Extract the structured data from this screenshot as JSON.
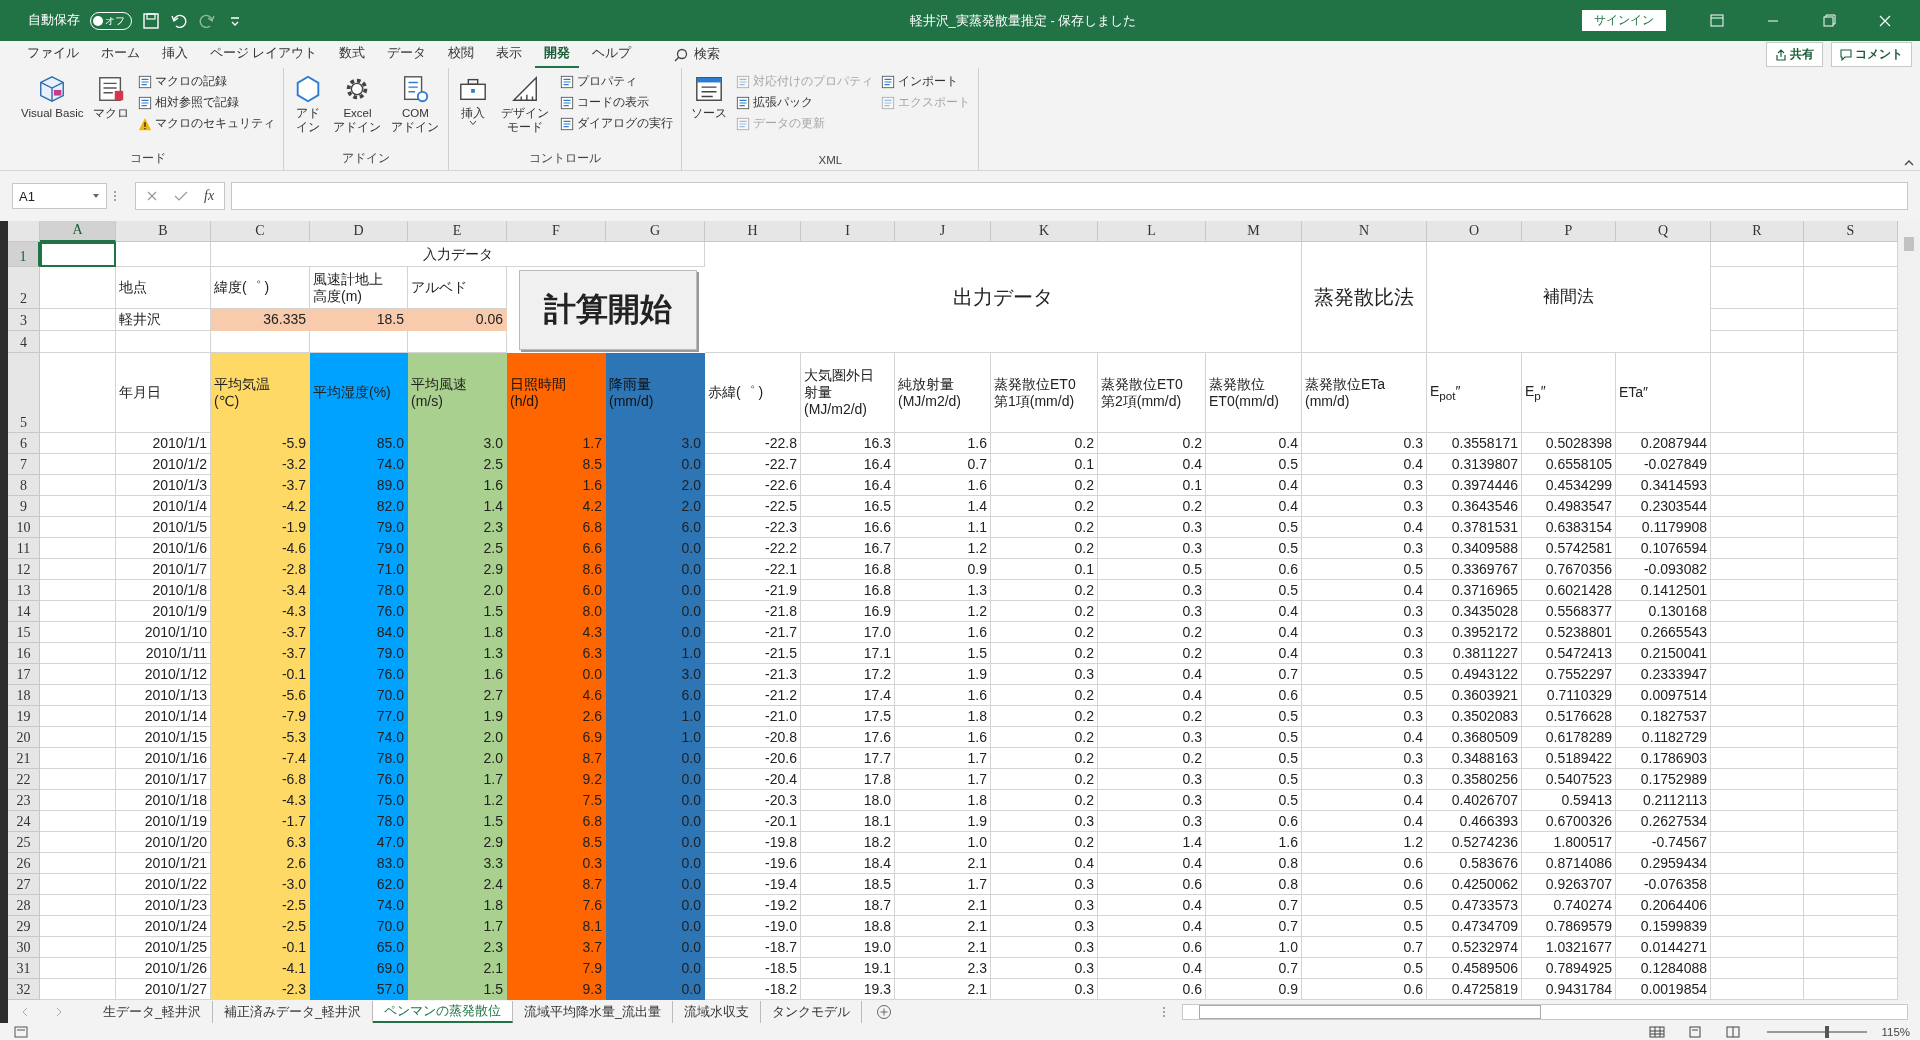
{
  "window": {
    "autosave_label": "自動保存",
    "autosave_state": "オフ",
    "autosave_on": false,
    "title": "軽井沢_実蒸発散量推定  -  保存しました",
    "signin": "サインイン"
  },
  "ribbon_tabs": [
    {
      "label": "ファイル",
      "selected": false
    },
    {
      "label": "ホーム",
      "selected": false
    },
    {
      "label": "挿入",
      "selected": false
    },
    {
      "label": "ページ レイアウト",
      "selected": false
    },
    {
      "label": "数式",
      "selected": false
    },
    {
      "label": "データ",
      "selected": false
    },
    {
      "label": "校閲",
      "selected": false
    },
    {
      "label": "表示",
      "selected": false
    },
    {
      "label": "開発",
      "selected": true
    },
    {
      "label": "ヘルプ",
      "selected": false
    }
  ],
  "search": {
    "label": "検索"
  },
  "share": "共有",
  "comment": "コメント",
  "ribbon_groups": [
    {
      "label": "コード",
      "items": [
        {
          "kind": "large",
          "label": "Visual Basic",
          "disabled": false
        },
        {
          "kind": "large",
          "label": "マクロ",
          "disabled": false
        },
        {
          "kind": "small",
          "label": "マクロの記録",
          "disabled": false
        },
        {
          "kind": "small",
          "label": "相対参照で記録",
          "disabled": false
        },
        {
          "kind": "small",
          "label": "マクロのセキュリティ",
          "disabled": false
        }
      ]
    },
    {
      "label": "アドイン",
      "items": [
        {
          "kind": "large",
          "label": "アドイン",
          "disabled": false
        },
        {
          "kind": "large",
          "label": "Excel\nアドイン",
          "disabled": false
        },
        {
          "kind": "large",
          "label": "COM\nアドイン",
          "disabled": false
        }
      ]
    },
    {
      "label": "コントロール",
      "items": [
        {
          "kind": "large",
          "label": "挿入",
          "disabled": false
        },
        {
          "kind": "large",
          "label": "デザインモード",
          "disabled": false
        },
        {
          "kind": "small",
          "label": "プロパティ",
          "disabled": false
        },
        {
          "kind": "small",
          "label": "コードの表示",
          "disabled": false
        },
        {
          "kind": "small",
          "label": "ダイアログの実行",
          "disabled": false
        }
      ]
    },
    {
      "label": "XML",
      "items": [
        {
          "kind": "large",
          "label": "ソース",
          "disabled": false
        },
        {
          "kind": "small",
          "label": "対応付けのプロパティ",
          "disabled": true
        },
        {
          "kind": "small",
          "label": "拡張パック",
          "disabled": false
        },
        {
          "kind": "small",
          "label": "データの更新",
          "disabled": true
        },
        {
          "kind": "small",
          "label": "インポート",
          "disabled": false
        },
        {
          "kind": "small",
          "label": "エクスポート",
          "disabled": true
        }
      ]
    }
  ],
  "formula_bar": {
    "name_box": "A1",
    "function_label": "fx"
  },
  "sheet": {
    "column_headers": [
      {
        "label": "A",
        "selected": true
      },
      {
        "label": "B",
        "selected": false
      },
      {
        "label": "C",
        "selected": false
      },
      {
        "label": "D",
        "selected": false
      },
      {
        "label": "E",
        "selected": false
      },
      {
        "label": "F",
        "selected": false
      },
      {
        "label": "G",
        "selected": false
      },
      {
        "label": "H",
        "selected": false
      },
      {
        "label": "I",
        "selected": false
      },
      {
        "label": "J",
        "selected": false
      },
      {
        "label": "K",
        "selected": false
      },
      {
        "label": "L",
        "selected": false
      },
      {
        "label": "M",
        "selected": false
      },
      {
        "label": "N",
        "selected": false
      },
      {
        "label": "O",
        "selected": false
      },
      {
        "label": "P",
        "selected": false
      },
      {
        "label": "Q",
        "selected": false
      },
      {
        "label": "R",
        "selected": false
      },
      {
        "label": "S",
        "selected": false
      }
    ],
    "row_headers": [
      {
        "label": "1",
        "selected": true
      },
      {
        "label": "2",
        "selected": false
      },
      {
        "label": "3",
        "selected": false
      },
      {
        "label": "4",
        "selected": false
      },
      {
        "label": "5",
        "selected": false
      },
      {
        "label": "6",
        "selected": false
      },
      {
        "label": "7",
        "selected": false
      },
      {
        "label": "8",
        "selected": false
      },
      {
        "label": "9",
        "selected": false
      },
      {
        "label": "10",
        "selected": false
      },
      {
        "label": "11",
        "selected": false
      },
      {
        "label": "12",
        "selected": false
      },
      {
        "label": "13",
        "selected": false
      },
      {
        "label": "14",
        "selected": false
      },
      {
        "label": "15",
        "selected": false
      },
      {
        "label": "16",
        "selected": false
      },
      {
        "label": "17",
        "selected": false
      },
      {
        "label": "18",
        "selected": false
      },
      {
        "label": "19",
        "selected": false
      },
      {
        "label": "20",
        "selected": false
      },
      {
        "label": "21",
        "selected": false
      },
      {
        "label": "22",
        "selected": false
      },
      {
        "label": "23",
        "selected": false
      },
      {
        "label": "24",
        "selected": false
      },
      {
        "label": "25",
        "selected": false
      },
      {
        "label": "26",
        "selected": false
      },
      {
        "label": "27",
        "selected": false
      },
      {
        "label": "28",
        "selected": false
      },
      {
        "label": "29",
        "selected": false
      },
      {
        "label": "30",
        "selected": false
      },
      {
        "label": "31",
        "selected": false
      },
      {
        "label": "32",
        "selected": false
      }
    ],
    "input_title": "入力データ",
    "output_title": "出力データ",
    "ratio_title": "蒸発散比法",
    "interp_title": "補間法",
    "site": {
      "label": "地点",
      "value": "軽井沢"
    },
    "params": [
      {
        "label": "緯度(゜ )",
        "value": "36.335"
      },
      {
        "label": "風速計地上高度(m)",
        "value": "18.5"
      },
      {
        "label": "アルベド",
        "value": "0.06"
      }
    ],
    "button": "計算開始",
    "date_header": "年月日",
    "input_columns": [
      {
        "header": "平均気温\n(℃)",
        "color": "#ffd966"
      },
      {
        "header": "平均湿度(%)",
        "color": "#00a2ff"
      },
      {
        "header": "平均風速\n(m/s)",
        "color": "#a9d08e"
      },
      {
        "header": "日照時間\n(h/d)",
        "color": "#ff6600"
      },
      {
        "header": "降雨量\n(mm/d)",
        "color": "#2e75b6"
      }
    ],
    "output_columns": [
      {
        "header": "赤緯(゜ )"
      },
      {
        "header": "大気圏外日射量\n(MJ/m2/d)"
      },
      {
        "header": "純放射量\n(MJ/m2/d)"
      },
      {
        "header": "蒸発散位ET0\n第1項(mm/d)"
      },
      {
        "header": "蒸発散位ET0\n第2項(mm/d)"
      },
      {
        "header": "蒸発散位\nET0(mm/d)"
      },
      {
        "header": "蒸発散位ETa\n(mm/d)"
      },
      {
        "header": "E$_{pot}$″"
      },
      {
        "header": "E$_{p}$″"
      },
      {
        "header": "ETa″"
      }
    ],
    "rows": [
      [
        "2010/1/1",
        "-5.9",
        "85.0",
        "3.0",
        "1.7",
        "3.0",
        "-22.8",
        "16.3",
        "1.6",
        "0.2",
        "0.2",
        "0.4",
        "0.3",
        "0.3558171",
        "0.5028398",
        "0.2087944"
      ],
      [
        "2010/1/2",
        "-3.2",
        "74.0",
        "2.5",
        "8.5",
        "0.0",
        "-22.7",
        "16.4",
        "0.7",
        "0.1",
        "0.4",
        "0.5",
        "0.4",
        "0.3139807",
        "0.6558105",
        "-0.027849"
      ],
      [
        "2010/1/3",
        "-3.7",
        "89.0",
        "1.6",
        "1.6",
        "2.0",
        "-22.6",
        "16.4",
        "1.6",
        "0.2",
        "0.1",
        "0.4",
        "0.3",
        "0.3974446",
        "0.4534299",
        "0.3414593"
      ],
      [
        "2010/1/4",
        "-4.2",
        "82.0",
        "1.4",
        "4.2",
        "2.0",
        "-22.5",
        "16.5",
        "1.4",
        "0.2",
        "0.2",
        "0.4",
        "0.3",
        "0.3643546",
        "0.4983547",
        "0.2303544"
      ],
      [
        "2010/1/5",
        "-1.9",
        "79.0",
        "2.3",
        "6.8",
        "6.0",
        "-22.3",
        "16.6",
        "1.1",
        "0.2",
        "0.3",
        "0.5",
        "0.4",
        "0.3781531",
        "0.6383154",
        "0.1179908"
      ],
      [
        "2010/1/6",
        "-4.6",
        "79.0",
        "2.5",
        "6.6",
        "0.0",
        "-22.2",
        "16.7",
        "1.2",
        "0.2",
        "0.3",
        "0.5",
        "0.3",
        "0.3409588",
        "0.5742581",
        "0.1076594"
      ],
      [
        "2010/1/7",
        "-2.8",
        "71.0",
        "2.9",
        "8.6",
        "0.0",
        "-22.1",
        "16.8",
        "0.9",
        "0.1",
        "0.5",
        "0.6",
        "0.5",
        "0.3369767",
        "0.7670356",
        "-0.093082"
      ],
      [
        "2010/1/8",
        "-3.4",
        "78.0",
        "2.0",
        "6.0",
        "0.0",
        "-21.9",
        "16.8",
        "1.3",
        "0.2",
        "0.3",
        "0.5",
        "0.4",
        "0.3716965",
        "0.6021428",
        "0.1412501"
      ],
      [
        "2010/1/9",
        "-4.3",
        "76.0",
        "1.5",
        "8.0",
        "0.0",
        "-21.8",
        "16.9",
        "1.2",
        "0.2",
        "0.3",
        "0.4",
        "0.3",
        "0.3435028",
        "0.5568377",
        "0.130168"
      ],
      [
        "2010/1/10",
        "-3.7",
        "84.0",
        "1.8",
        "4.3",
        "0.0",
        "-21.7",
        "17.0",
        "1.6",
        "0.2",
        "0.2",
        "0.4",
        "0.3",
        "0.3952172",
        "0.5238801",
        "0.2665543"
      ],
      [
        "2010/1/11",
        "-3.7",
        "79.0",
        "1.3",
        "6.3",
        "1.0",
        "-21.5",
        "17.1",
        "1.5",
        "0.2",
        "0.2",
        "0.4",
        "0.3",
        "0.3811227",
        "0.5472413",
        "0.2150041"
      ],
      [
        "2010/1/12",
        "-0.1",
        "76.0",
        "1.6",
        "0.0",
        "3.0",
        "-21.3",
        "17.2",
        "1.9",
        "0.3",
        "0.4",
        "0.7",
        "0.5",
        "0.4943122",
        "0.7552297",
        "0.2333947"
      ],
      [
        "2010/1/13",
        "-5.6",
        "70.0",
        "2.7",
        "4.6",
        "6.0",
        "-21.2",
        "17.4",
        "1.6",
        "0.2",
        "0.4",
        "0.6",
        "0.5",
        "0.3603921",
        "0.7110329",
        "0.0097514"
      ],
      [
        "2010/1/14",
        "-7.9",
        "77.0",
        "1.9",
        "2.6",
        "1.0",
        "-21.0",
        "17.5",
        "1.8",
        "0.2",
        "0.2",
        "0.5",
        "0.3",
        "0.3502083",
        "0.5176628",
        "0.1827537"
      ],
      [
        "2010/1/15",
        "-5.3",
        "74.0",
        "2.0",
        "6.9",
        "1.0",
        "-20.8",
        "17.6",
        "1.6",
        "0.2",
        "0.3",
        "0.5",
        "0.4",
        "0.3680509",
        "0.6178289",
        "0.1182729"
      ],
      [
        "2010/1/16",
        "-7.4",
        "78.0",
        "2.0",
        "8.7",
        "0.0",
        "-20.6",
        "17.7",
        "1.7",
        "0.2",
        "0.2",
        "0.5",
        "0.3",
        "0.3488163",
        "0.5189422",
        "0.1786903"
      ],
      [
        "2010/1/17",
        "-6.8",
        "76.0",
        "1.7",
        "9.2",
        "0.0",
        "-20.4",
        "17.8",
        "1.7",
        "0.2",
        "0.3",
        "0.5",
        "0.3",
        "0.3580256",
        "0.5407523",
        "0.1752989"
      ],
      [
        "2010/1/18",
        "-4.3",
        "75.0",
        "1.2",
        "7.5",
        "0.0",
        "-20.3",
        "18.0",
        "1.8",
        "0.2",
        "0.3",
        "0.5",
        "0.4",
        "0.4026707",
        "0.59413",
        "0.2112113"
      ],
      [
        "2010/1/19",
        "-1.7",
        "78.0",
        "1.5",
        "6.8",
        "0.0",
        "-20.1",
        "18.1",
        "1.9",
        "0.3",
        "0.3",
        "0.6",
        "0.4",
        "0.466393",
        "0.6700326",
        "0.2627534"
      ],
      [
        "2010/1/20",
        "6.3",
        "47.0",
        "2.9",
        "8.5",
        "0.0",
        "-19.8",
        "18.2",
        "1.0",
        "0.2",
        "1.4",
        "1.6",
        "1.2",
        "0.5274236",
        "1.800517",
        "-0.74567"
      ],
      [
        "2010/1/21",
        "2.6",
        "83.0",
        "3.3",
        "0.3",
        "0.0",
        "-19.6",
        "18.4",
        "2.1",
        "0.4",
        "0.4",
        "0.8",
        "0.6",
        "0.583676",
        "0.8714086",
        "0.2959434"
      ],
      [
        "2010/1/22",
        "-3.0",
        "62.0",
        "2.4",
        "8.7",
        "0.0",
        "-19.4",
        "18.5",
        "1.7",
        "0.3",
        "0.6",
        "0.8",
        "0.6",
        "0.4250062",
        "0.9263707",
        "-0.076358"
      ],
      [
        "2010/1/23",
        "-2.5",
        "74.0",
        "1.8",
        "7.6",
        "0.0",
        "-19.2",
        "18.7",
        "2.1",
        "0.3",
        "0.4",
        "0.7",
        "0.5",
        "0.4733573",
        "0.740274",
        "0.2064406"
      ],
      [
        "2010/1/24",
        "-2.5",
        "70.0",
        "1.7",
        "8.1",
        "0.0",
        "-19.0",
        "18.8",
        "2.1",
        "0.3",
        "0.4",
        "0.7",
        "0.5",
        "0.4734709",
        "0.7869579",
        "0.1599839"
      ],
      [
        "2010/1/25",
        "-0.1",
        "65.0",
        "2.3",
        "3.7",
        "0.0",
        "-18.7",
        "19.0",
        "2.1",
        "0.3",
        "0.6",
        "1.0",
        "0.7",
        "0.5232974",
        "1.0321677",
        "0.0144271"
      ],
      [
        "2010/1/26",
        "-4.1",
        "69.0",
        "2.1",
        "7.9",
        "0.0",
        "-18.5",
        "19.1",
        "2.3",
        "0.3",
        "0.4",
        "0.7",
        "0.5",
        "0.4589506",
        "0.7894925",
        "0.1284088"
      ],
      [
        "2010/1/27",
        "-2.3",
        "57.0",
        "1.5",
        "9.3",
        "0.0",
        "-18.2",
        "19.3",
        "2.1",
        "0.3",
        "0.6",
        "0.9",
        "0.6",
        "0.4725819",
        "0.9431784",
        "0.0019854"
      ]
    ]
  },
  "sheet_tabs": [
    {
      "label": "生データ_軽井沢",
      "selected": false
    },
    {
      "label": "補正済みデータ_軽井沢",
      "selected": false
    },
    {
      "label": "ペンマンの蒸発散位",
      "selected": true
    },
    {
      "label": "流域平均降水量_流出量",
      "selected": false
    },
    {
      "label": "流域水収支",
      "selected": false
    },
    {
      "label": "タンクモデル",
      "selected": false
    }
  ],
  "status_bar": {
    "zoom": {
      "level": 0.6,
      "reading": "115%"
    }
  }
}
